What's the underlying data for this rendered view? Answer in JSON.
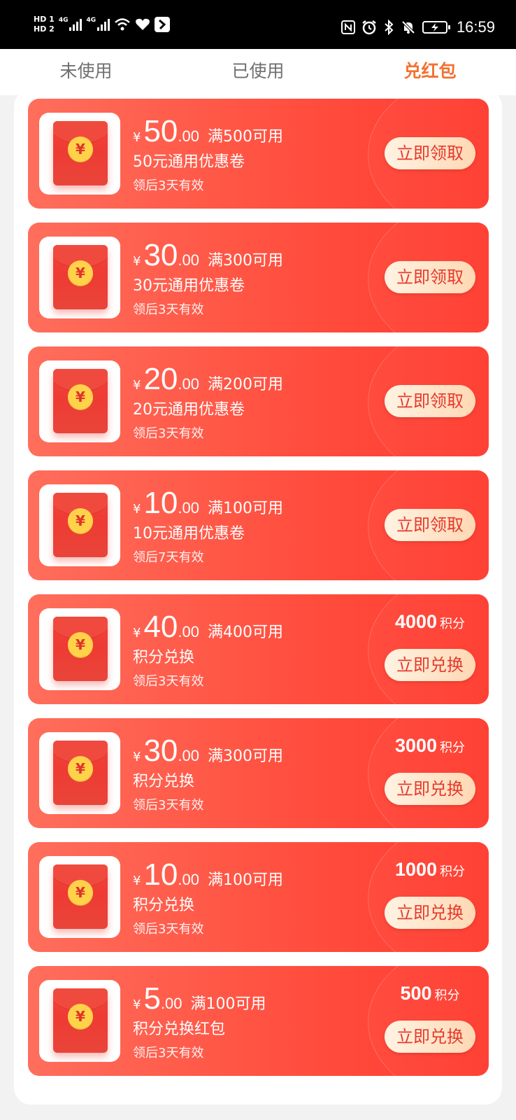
{
  "status_bar": {
    "hd1": "HD 1",
    "hd2": "HD 2",
    "net1": "4G",
    "net2": "4G",
    "time": "16:59"
  },
  "tabs": [
    {
      "label": "未使用",
      "active": false
    },
    {
      "label": "已使用",
      "active": false
    },
    {
      "label": "兑红包",
      "active": true
    }
  ],
  "currency_symbol": "¥",
  "coupons": [
    {
      "amount": "50",
      "decimal": ".00",
      "condition": "满500可用",
      "description": "50元通用优惠卷",
      "validity": "领后3天有效",
      "action": "立即领取",
      "points": null,
      "points_unit": null
    },
    {
      "amount": "30",
      "decimal": ".00",
      "condition": "满300可用",
      "description": "30元通用优惠卷",
      "validity": "领后3天有效",
      "action": "立即领取",
      "points": null,
      "points_unit": null
    },
    {
      "amount": "20",
      "decimal": ".00",
      "condition": "满200可用",
      "description": "20元通用优惠卷",
      "validity": "领后3天有效",
      "action": "立即领取",
      "points": null,
      "points_unit": null
    },
    {
      "amount": "10",
      "decimal": ".00",
      "condition": "满100可用",
      "description": "10元通用优惠卷",
      "validity": "领后7天有效",
      "action": "立即领取",
      "points": null,
      "points_unit": null
    },
    {
      "amount": "40",
      "decimal": ".00",
      "condition": "满400可用",
      "description": "积分兑换",
      "validity": "领后3天有效",
      "action": "立即兑换",
      "points": "4000",
      "points_unit": "积分"
    },
    {
      "amount": "30",
      "decimal": ".00",
      "condition": "满300可用",
      "description": "积分兑换",
      "validity": "领后3天有效",
      "action": "立即兑换",
      "points": "3000",
      "points_unit": "积分"
    },
    {
      "amount": "10",
      "decimal": ".00",
      "condition": "满100可用",
      "description": "积分兑换",
      "validity": "领后3天有效",
      "action": "立即兑换",
      "points": "1000",
      "points_unit": "积分"
    },
    {
      "amount": "5",
      "decimal": ".00",
      "condition": "满100可用",
      "description": "积分兑换红包",
      "validity": "领后3天有效",
      "action": "立即兑换",
      "points": "500",
      "points_unit": "积分"
    }
  ],
  "icons": {
    "envelope": "red-envelope-icon",
    "coin": "¥",
    "wifi": "wifi-icon",
    "heart": "heart-icon",
    "app": "app-icon",
    "nfc": "nfc-icon",
    "alarm": "alarm-icon",
    "bluetooth": "bluetooth-icon",
    "bell_off": "bell-off-icon",
    "battery": "battery-charging-icon"
  },
  "colors": {
    "accent_tab": "#f4712f",
    "card_start": "#ff6e5c",
    "card_end": "#ff3b2f",
    "button_text": "#e6392d",
    "coin": "#ffd24a"
  }
}
